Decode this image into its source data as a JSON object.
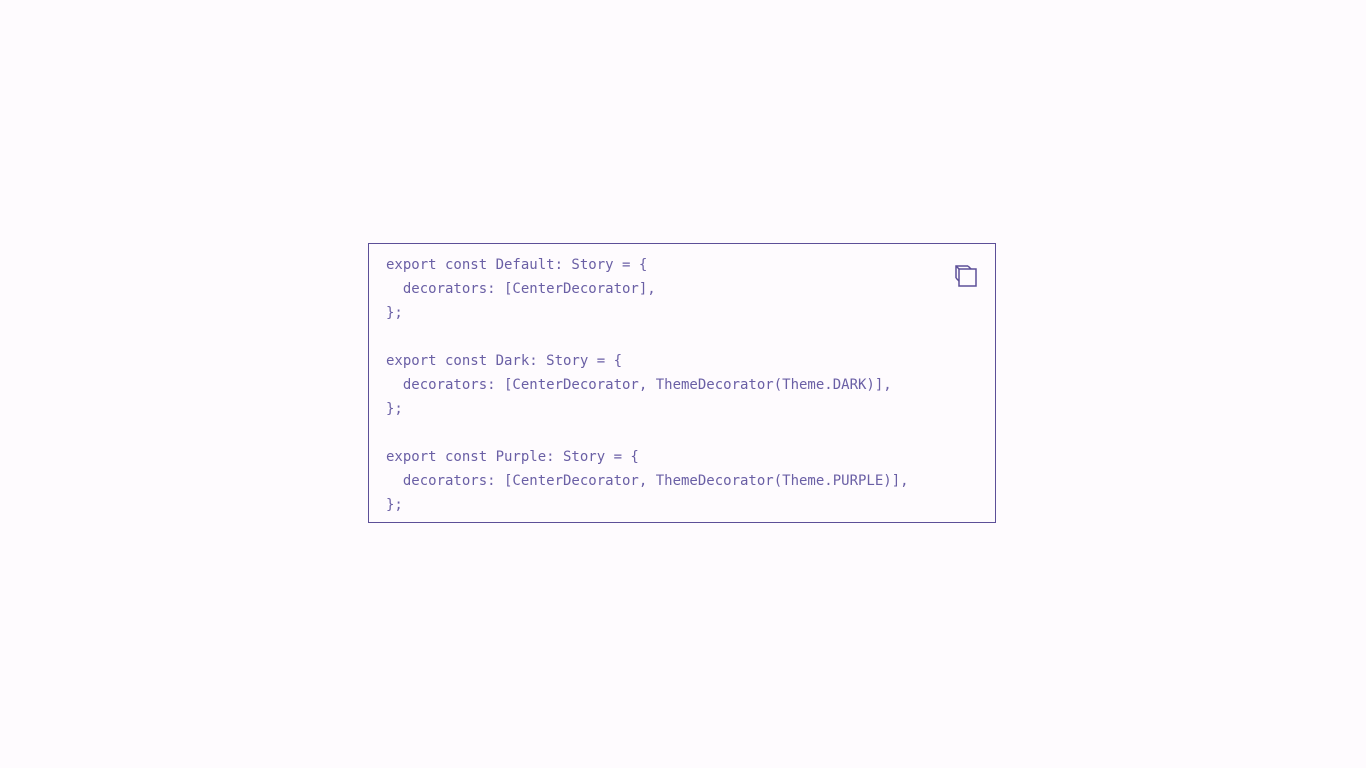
{
  "code_block": {
    "lines": [
      "export const Default: Story = {",
      "  decorators: [CenterDecorator],",
      "};",
      "",
      "export const Dark: Story = {",
      "  decorators: [CenterDecorator, ThemeDecorator(Theme.DARK)],",
      "};",
      "",
      "export const Purple: Story = {",
      "  decorators: [CenterDecorator, ThemeDecorator(Theme.PURPLE)],",
      "};"
    ],
    "copy_icon": "copy-icon"
  },
  "colors": {
    "background": "#fefbfe",
    "accent": "#5d4f98",
    "code_text": "#6a5fa5"
  }
}
